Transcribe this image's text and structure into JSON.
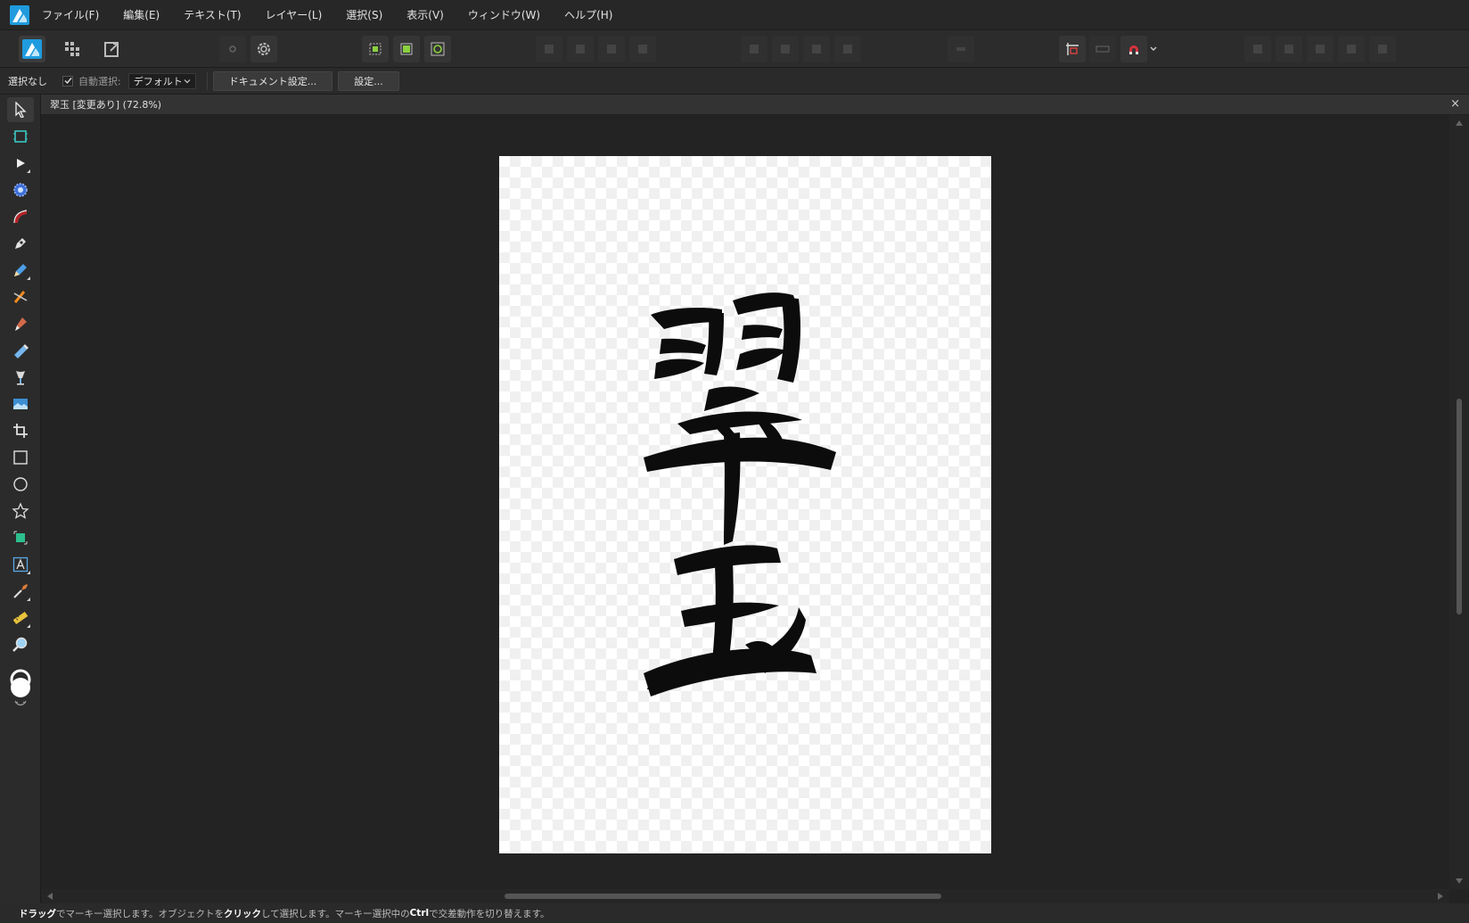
{
  "colors": {
    "accent": "#1f9bde",
    "menubar_bg": "#272727",
    "toolbar_bg": "#2c2c2c",
    "canvas_bg": "#232323",
    "ink": "#0c0c0c"
  },
  "menu": {
    "items": [
      {
        "label": "ファイル(F)"
      },
      {
        "label": "編集(E)"
      },
      {
        "label": "テキスト(T)"
      },
      {
        "label": "レイヤー(L)"
      },
      {
        "label": "選択(S)"
      },
      {
        "label": "表示(V)"
      },
      {
        "label": "ウィンドウ(W)"
      },
      {
        "label": "ヘルプ(H)"
      }
    ]
  },
  "context_bar": {
    "selection_status": "選択なし",
    "auto_select_label": "自動選択:",
    "auto_select_checked": true,
    "auto_select_value": "デフォルト",
    "document_setup_button": "ドキュメント設定...",
    "settings_button": "設定..."
  },
  "document": {
    "tab_title": "翠玉 [変更あり] (72.8%)",
    "close_glyph": "×"
  },
  "status_bar": {
    "part1_bold": "ドラッグ",
    "part2": "でマーキー選択します。オブジェクトを",
    "part3_bold": "クリック",
    "part4": "して選択します。マーキー選択中の",
    "part5_bold": "Ctrl",
    "part6": "で交差動作を切り替えます。"
  },
  "tools": [
    "move-tool-icon",
    "artboard-tool-icon",
    "node-tool-icon",
    "corner-tool-icon",
    "vector-brush-tool-icon",
    "pen-tool-icon",
    "pencil-tool-icon",
    "vector-crop-icon",
    "paint-brush-tool-icon",
    "pixel-brush-icon",
    "fill-tool-icon",
    "place-image-icon",
    "crop-tool-icon",
    "rectangle-tool-icon",
    "ellipse-tool-icon",
    "star-tool-icon",
    "shape-tool-icon",
    "frame-text-tool-icon",
    "color-picker-tool-icon",
    "measure-tool-icon",
    "zoom-tool-icon"
  ]
}
